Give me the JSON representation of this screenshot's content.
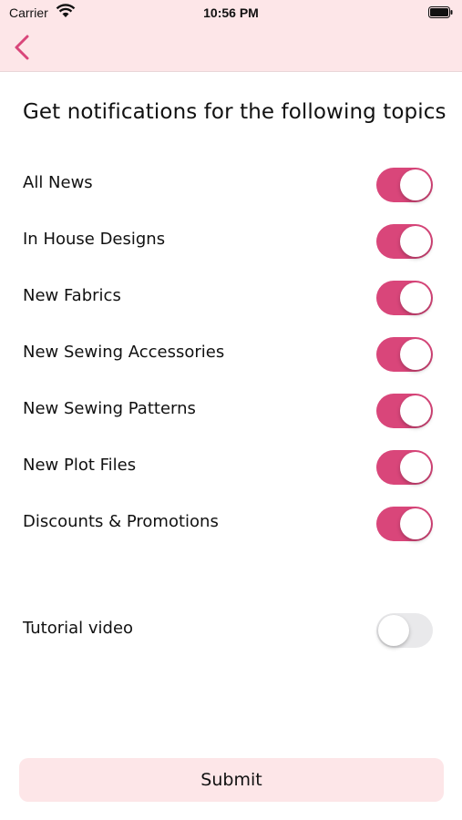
{
  "status_bar": {
    "carrier": "Carrier",
    "time": "10:56 PM",
    "wifi_icon": "wifi-icon",
    "battery_icon": "battery-icon"
  },
  "nav": {
    "back_icon": "chevron-left-icon",
    "accent_color": "#d9467a",
    "background_color": "#fde6e8"
  },
  "heading": "Get notifications for the following topics",
  "topics": [
    {
      "label": "All News",
      "enabled": true
    },
    {
      "label": "In House Designs",
      "enabled": true
    },
    {
      "label": "New Fabrics",
      "enabled": true
    },
    {
      "label": "New Sewing Accessories",
      "enabled": true
    },
    {
      "label": "New Sewing Patterns",
      "enabled": true
    },
    {
      "label": "New Plot Files",
      "enabled": true
    },
    {
      "label": "Discounts & Promotions",
      "enabled": true
    }
  ],
  "tutorial": {
    "label": "Tutorial video",
    "enabled": false
  },
  "submit_label": "Submit"
}
